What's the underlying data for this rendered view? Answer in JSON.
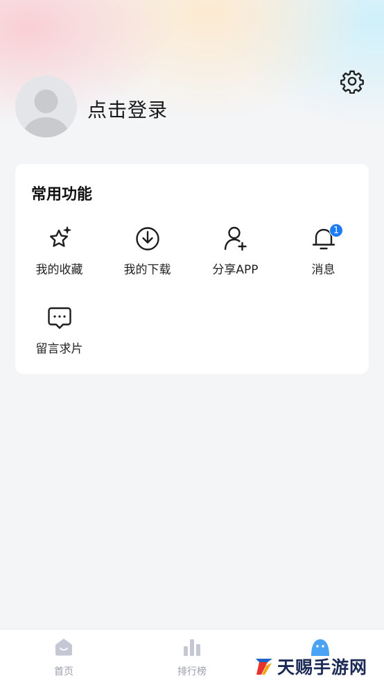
{
  "header": {
    "login_text": "点击登录",
    "settings_icon": "gear-icon",
    "avatar_icon": "default-avatar-icon"
  },
  "common_functions": {
    "title": "常用功能",
    "items": [
      {
        "label": "我的收藏",
        "icon": "star-sparkle-icon"
      },
      {
        "label": "我的下载",
        "icon": "download-icon"
      },
      {
        "label": "分享APP",
        "icon": "add-user-icon"
      },
      {
        "label": "消息",
        "icon": "bell-icon",
        "badge": "1"
      },
      {
        "label": "留言求片",
        "icon": "chat-bubble-icon"
      }
    ]
  },
  "tabbar": {
    "items": [
      {
        "label": "首页",
        "icon": "home-icon"
      },
      {
        "label": "排行榜",
        "icon": "bar-chart-icon"
      },
      {
        "label": "",
        "icon": "mine-face-icon",
        "active": true
      }
    ]
  },
  "watermark": {
    "text": "天赐手游网"
  },
  "colors": {
    "accent": "#1e7cf2",
    "inactive_tab": "#c5c8d4",
    "background": "#f4f5f7"
  }
}
